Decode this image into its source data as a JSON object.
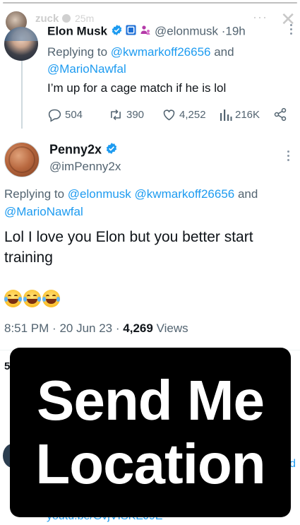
{
  "story": {
    "username": "zuck",
    "time": "25m",
    "more": "···",
    "close": "✕"
  },
  "tweet1": {
    "name": "Elon Musk",
    "handle": "@elonmusk",
    "sep": "·",
    "time": "19h",
    "reply_prefix": "Replying to",
    "reply_user1": "@kwmarkoff26656",
    "reply_and": "and",
    "reply_user2": "@MarioNawfal",
    "text": "I’m up for a cage match if he is lol",
    "stats": {
      "replies": "504",
      "retweets": "390",
      "likes": "4,252",
      "views": "216K"
    }
  },
  "tweet2": {
    "name": "Penny2x",
    "handle": "@imPenny2x",
    "reply_prefix": "Replying to",
    "reply_user1": "@elonmusk",
    "reply_user2": "@kwmarkoff26656",
    "reply_and": "and",
    "reply_user3": "@MarioNawfal",
    "text": "Lol I love you Elon but you better start training",
    "time": "8:51 PM",
    "sep": "·",
    "date": "20 Jun 23",
    "views_count": "4,269",
    "views_label": "Views"
  },
  "peek": {
    "stat_char": "5",
    "link_fragment": "d",
    "url_fragment": "youtu.be/GvjVISKEJ9E"
  },
  "sticker": {
    "line1": "Send Me",
    "line2": "Location"
  },
  "colors": {
    "link": "#1d9bf0",
    "verified": "#1d9bf0",
    "muted": "#536471",
    "sticker_bg": "#000000"
  }
}
